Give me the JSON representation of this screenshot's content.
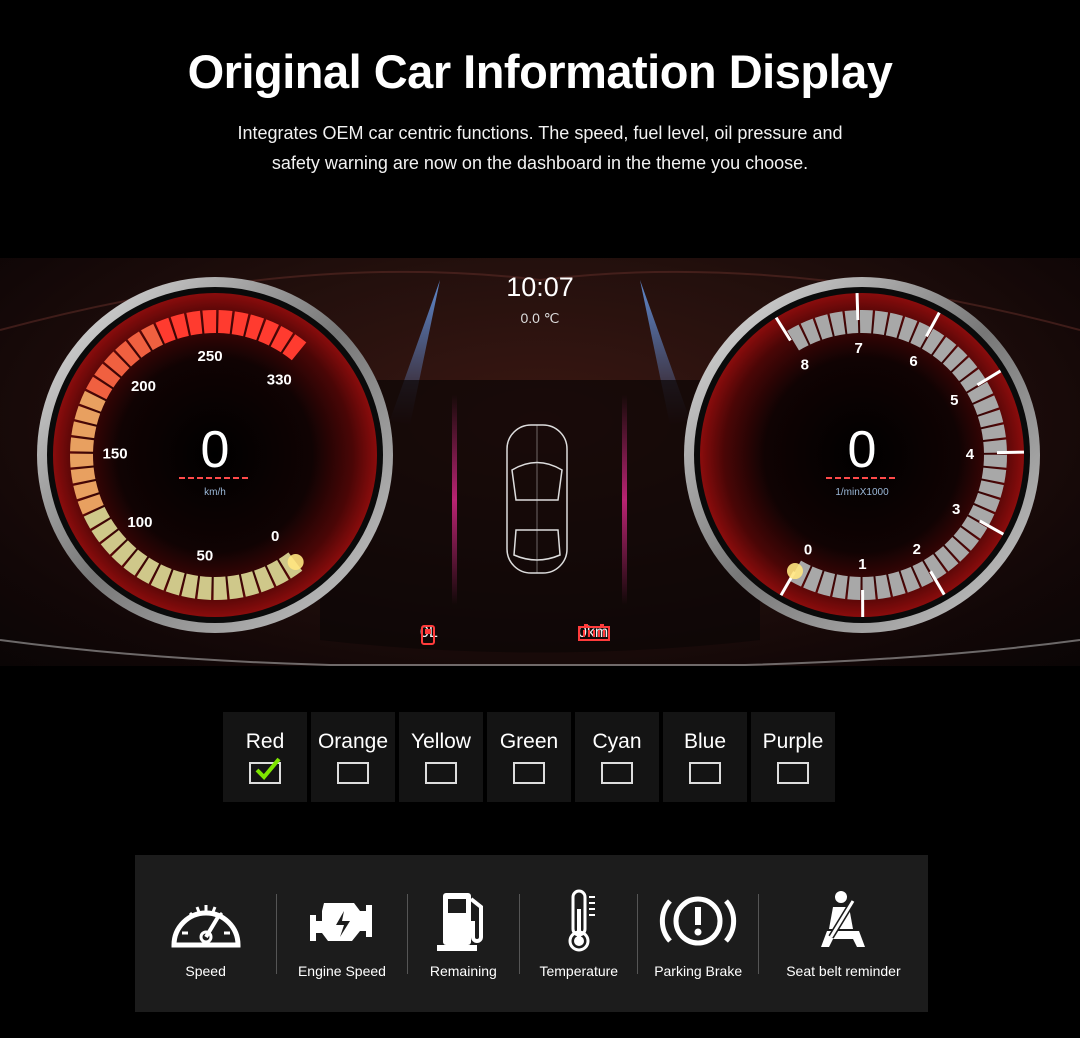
{
  "header": {
    "title": "Original Car Information Display",
    "subtitle_line1": "Integrates OEM car centric functions. The speed, fuel level, oil pressure and",
    "subtitle_line2": "safety warning are now on the dashboard in the theme you choose."
  },
  "dashboard": {
    "time": "10:07",
    "temperature": "0.0 ℃",
    "speedometer": {
      "value": "0",
      "unit": "km/h",
      "labels": [
        "0",
        "50",
        "100",
        "150",
        "200",
        "250",
        "330"
      ],
      "accent": "#ff3b2f"
    },
    "tachometer": {
      "value": "0",
      "unit": "1/minX1000",
      "labels": [
        "0",
        "1",
        "2",
        "3",
        "4",
        "5",
        "6",
        "7",
        "8"
      ],
      "accent": "#ff3b2f"
    },
    "fuel": "0L",
    "range": "0km"
  },
  "theme_selector": {
    "selected": "Red",
    "options": [
      {
        "label": "Red",
        "checked": true
      },
      {
        "label": "Orange",
        "checked": false
      },
      {
        "label": "Yellow",
        "checked": false
      },
      {
        "label": "Green",
        "checked": false
      },
      {
        "label": "Cyan",
        "checked": false
      },
      {
        "label": "Blue",
        "checked": false
      },
      {
        "label": "Purple",
        "checked": false
      }
    ],
    "check_color": "#7ee600"
  },
  "features": [
    {
      "icon": "speedometer-icon",
      "label": "Speed"
    },
    {
      "icon": "engine-icon",
      "label": "Engine Speed"
    },
    {
      "icon": "fuel-pump-icon",
      "label": "Remaining"
    },
    {
      "icon": "thermometer-icon",
      "label": "Temperature"
    },
    {
      "icon": "parking-brake-icon",
      "label": "Parking Brake"
    },
    {
      "icon": "seat-belt-icon",
      "label": "Seat belt reminder"
    }
  ]
}
